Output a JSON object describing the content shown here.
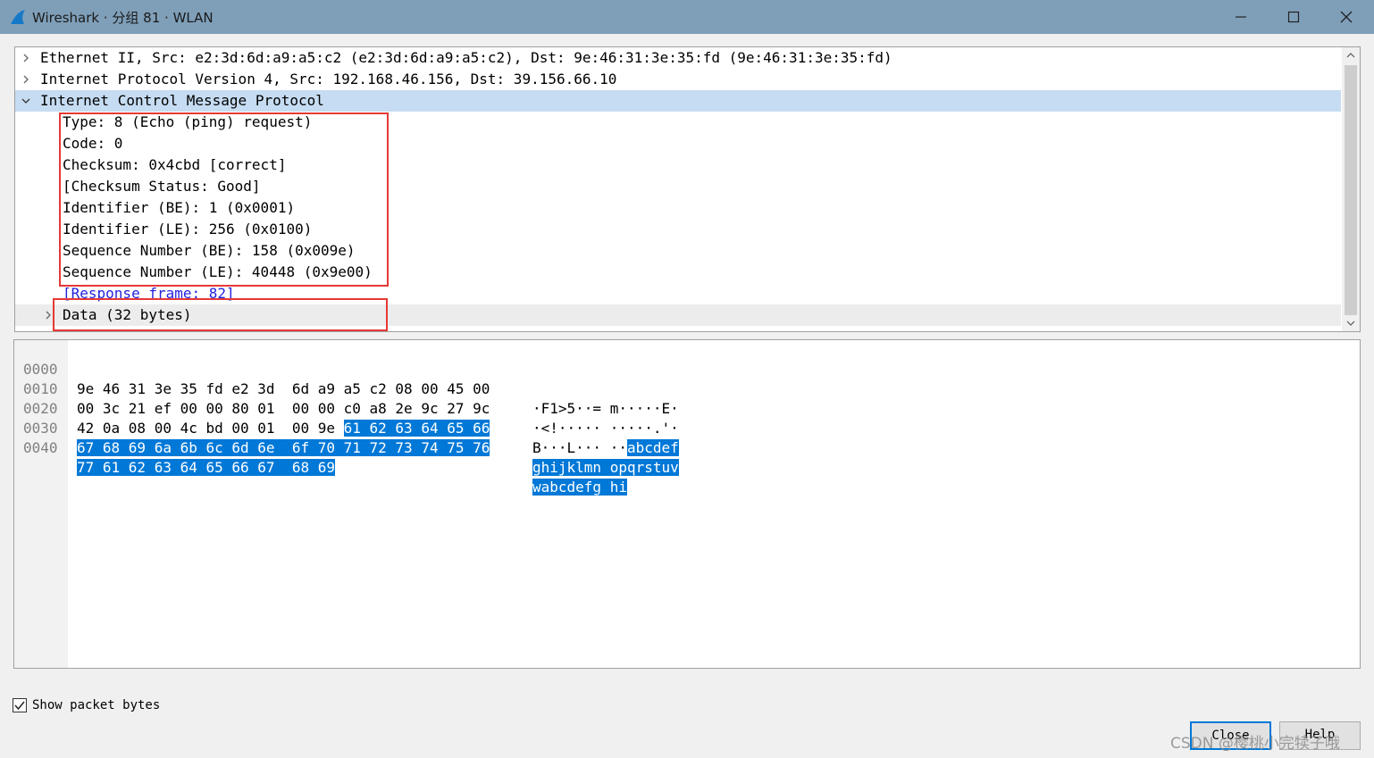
{
  "window": {
    "title": "Wireshark · 分组 81 · WLAN",
    "icon": "wireshark-fin-icon"
  },
  "tree": {
    "rows": [
      {
        "text": "Ethernet II, Src: e2:3d:6d:a9:a5:c2 (e2:3d:6d:a9:a5:c2), Dst: 9e:46:31:3e:35:fd (9e:46:31:3e:35:fd)",
        "expanded": false
      },
      {
        "text": "Internet Protocol Version 4, Src: 192.168.46.156, Dst: 39.156.66.10",
        "expanded": false
      },
      {
        "text": "Internet Control Message Protocol",
        "expanded": true,
        "selected": true
      },
      {
        "text": "Type: 8 (Echo (ping) request)"
      },
      {
        "text": "Code: 0"
      },
      {
        "text": "Checksum: 0x4cbd [correct]"
      },
      {
        "text": "[Checksum Status: Good]"
      },
      {
        "text": "Identifier (BE): 1 (0x0001)"
      },
      {
        "text": "Identifier (LE): 256 (0x0100)"
      },
      {
        "text": "Sequence Number (BE): 158 (0x009e)"
      },
      {
        "text": "Sequence Number (LE): 40448 (0x9e00)"
      },
      {
        "text": "[Response frame: 82]",
        "link": true
      },
      {
        "text": "Data (32 bytes)",
        "expanded": false
      }
    ]
  },
  "bytes": {
    "rows": [
      {
        "offset": "0000",
        "hex_plain": "9e 46 31 3e 35 fd e2 3d  6d a9 a5 c2 08 00 45 00",
        "hex_hl": "",
        "ascii_plain": "·F1>5··= m·····E·",
        "ascii_hl": ""
      },
      {
        "offset": "0010",
        "hex_plain": "00 3c 21 ef 00 00 80 01  00 00 c0 a8 2e 9c 27 9c",
        "hex_hl": "",
        "ascii_plain": "·<!····· ·····.'·",
        "ascii_hl": ""
      },
      {
        "offset": "0020",
        "hex_plain": "42 0a 08 00 4c bd 00 01  00 9e ",
        "hex_hl": "61 62 63 64 65 66",
        "ascii_plain": "B···L··· ··",
        "ascii_hl": "abcdef"
      },
      {
        "offset": "0030",
        "hex_plain": "",
        "hex_hl": "67 68 69 6a 6b 6c 6d 6e  6f 70 71 72 73 74 75 76",
        "ascii_plain": "",
        "ascii_hl": "ghijklmn opqrstuv"
      },
      {
        "offset": "0040",
        "hex_plain": "",
        "hex_hl": "77 61 62 63 64 65 66 67  68 69",
        "ascii_plain": "",
        "ascii_hl": "wabcdefg hi"
      }
    ]
  },
  "footer": {
    "show_bytes_label": "Show packet bytes",
    "show_bytes_checked": true,
    "close_label": "Close",
    "help_label": "Help"
  },
  "watermark": "CSDN @樱桃小完犊子哦",
  "colors": {
    "selection": "#c6dcf2",
    "byte_highlight": "#0078d7",
    "annotation": "#e53935",
    "link": "#2222dd"
  }
}
